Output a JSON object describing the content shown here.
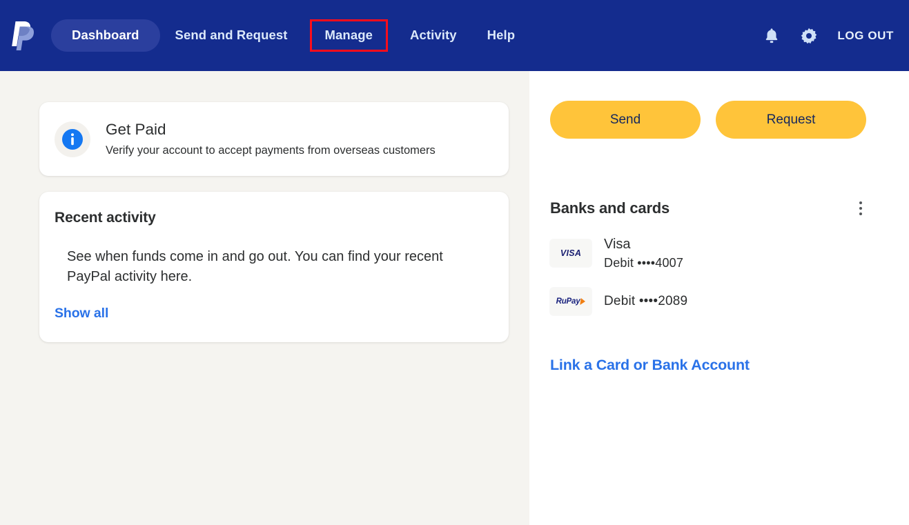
{
  "header": {
    "logo_icon": "paypal-logo",
    "nav": [
      {
        "label": "Dashboard",
        "active": true,
        "highlighted": false
      },
      {
        "label": "Send and Request",
        "active": false,
        "highlighted": false
      },
      {
        "label": "Manage",
        "active": false,
        "highlighted": true
      },
      {
        "label": "Activity",
        "active": false,
        "highlighted": false
      },
      {
        "label": "Help",
        "active": false,
        "highlighted": false
      }
    ],
    "notifications_icon": "bell-icon",
    "settings_icon": "gear-icon",
    "logout_label": "LOG OUT",
    "background_color": "#142C8E",
    "highlight_color": "#FC0D1B"
  },
  "main": {
    "get_paid": {
      "icon": "info-icon",
      "title": "Get Paid",
      "subtitle": "Verify your account to accept payments from overseas customers"
    },
    "recent_activity": {
      "title": "Recent activity",
      "body": "See when funds come in and go out. You can find your recent PayPal activity here.",
      "show_all_label": "Show all",
      "link_color": "#2A72E8"
    }
  },
  "sidebar": {
    "send_label": "Send",
    "request_label": "Request",
    "button_color": "#FFC43A",
    "banks_and_cards": {
      "title": "Banks and cards",
      "menu_icon": "kebab-menu-icon",
      "items": [
        {
          "brand": "VISA",
          "name": "Visa",
          "detail": "Debit ••••4007"
        },
        {
          "brand": "RuPay",
          "name": "",
          "detail": "Debit ••••2089"
        }
      ],
      "link_label": "Link a Card or Bank Account"
    }
  }
}
